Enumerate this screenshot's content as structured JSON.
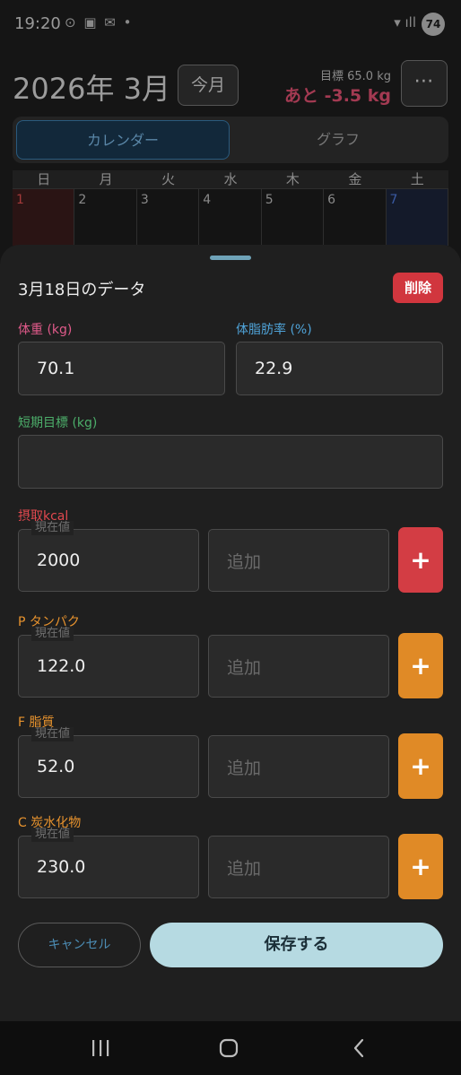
{
  "status_bar": {
    "time": "19:20",
    "left_icons": "⊙ ▣ ✉ •",
    "right_icons": "▾ ıll",
    "battery": "74"
  },
  "header": {
    "month_title": "2026年  3月",
    "today_button": "今月",
    "goal_weight": "目標 65.0 kg",
    "goal_remaining": "あと -3.5 kg",
    "more_button": "⋯"
  },
  "view_tabs": {
    "calendar": "カレンダー",
    "graph": "グラフ"
  },
  "calendar": {
    "weekdays": [
      "日",
      "月",
      "火",
      "水",
      "木",
      "金",
      "土"
    ],
    "first_row": [
      "1",
      "2",
      "3",
      "4",
      "5",
      "6",
      "7"
    ]
  },
  "sheet": {
    "title": "3月18日のデータ",
    "delete_button": "削除",
    "weight": {
      "label": "体重 (kg)",
      "value": "70.1"
    },
    "body_fat": {
      "label": "体脂肪率 (%)",
      "value": "22.9"
    },
    "short_goal": {
      "label": "短期目標 (kg)",
      "value": ""
    },
    "current_label": "現在値",
    "add_placeholder": "追加",
    "plus_label": "+",
    "kcal": {
      "label": "摂取kcal",
      "value": "2000"
    },
    "protein": {
      "label": "P タンパク",
      "value": "122.0"
    },
    "fat": {
      "label": "F 脂質",
      "value": "52.0"
    },
    "carbs": {
      "label": "C 炭水化物",
      "value": "230.0"
    },
    "cancel_button": "キャンセル",
    "save_button": "保存する"
  },
  "colors": {
    "accent_save": "#b6dae2",
    "delete": "#d1363e",
    "kcal_plus": "#d33d44",
    "macro_plus": "#e08a26"
  },
  "nav_icons": [
    "recent-apps-icon",
    "home-icon",
    "back-icon"
  ]
}
